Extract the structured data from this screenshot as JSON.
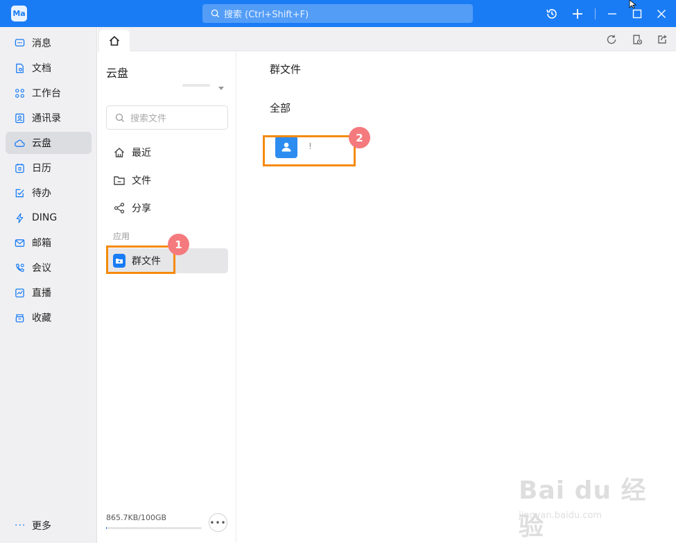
{
  "app": {
    "logo_text": "Ma",
    "search_placeholder": "搜索 (Ctrl+Shift+F)",
    "accent_color": "#1a7cf5"
  },
  "titlebar_icons": [
    "history-icon",
    "plus-icon",
    "minimize-icon",
    "maximize-icon",
    "close-icon"
  ],
  "leftnav": {
    "items": [
      {
        "label": "消息",
        "icon": "message-icon"
      },
      {
        "label": "文档",
        "icon": "document-icon"
      },
      {
        "label": "工作台",
        "icon": "workbench-icon"
      },
      {
        "label": "通讯录",
        "icon": "contacts-icon"
      },
      {
        "label": "云盘",
        "icon": "cloud-icon",
        "active": true
      },
      {
        "label": "日历",
        "icon": "calendar-icon"
      },
      {
        "label": "待办",
        "icon": "todo-icon"
      },
      {
        "label": "DING",
        "icon": "lightning-icon"
      },
      {
        "label": "邮箱",
        "icon": "mail-icon"
      },
      {
        "label": "会议",
        "icon": "meeting-icon"
      },
      {
        "label": "直播",
        "icon": "live-icon"
      },
      {
        "label": "收藏",
        "icon": "favorites-icon"
      }
    ],
    "more_label": "更多"
  },
  "tabstrip": {
    "right_icons": [
      "refresh-icon",
      "file-clock-icon",
      "share-out-icon"
    ]
  },
  "cloud": {
    "title": "云盘",
    "search_placeholder": "搜索文件",
    "items": [
      {
        "label": "最近",
        "icon": "home-icon"
      },
      {
        "label": "文件",
        "icon": "folder-icon"
      },
      {
        "label": "分享",
        "icon": "share-icon"
      }
    ],
    "section_label": "应用",
    "app_item": {
      "label": "群文件",
      "icon": "group-files-icon"
    },
    "storage_text": "865.7KB/100GB",
    "storage_used_fraction": 8.1e-06
  },
  "main": {
    "title": "群文件",
    "subtitle": "全部",
    "group": {
      "name": "!"
    }
  },
  "annotations": [
    "1",
    "2"
  ],
  "watermark": {
    "main": "Bai du 经验",
    "sub": "jingyan.baidu.com"
  }
}
